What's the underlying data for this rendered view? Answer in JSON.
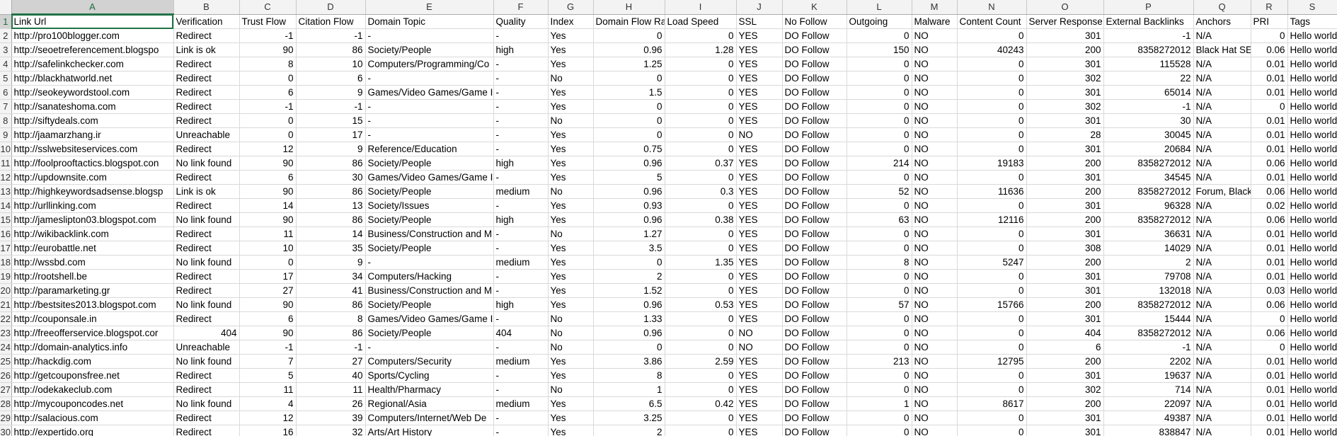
{
  "sheet": {
    "columns": [
      "A",
      "B",
      "C",
      "D",
      "E",
      "F",
      "G",
      "H",
      "I",
      "J",
      "K",
      "L",
      "M",
      "N",
      "O",
      "P",
      "Q",
      "R",
      "S"
    ],
    "numeric_columns": [
      2,
      3,
      7,
      8,
      11,
      13,
      14,
      15,
      17
    ],
    "header_row": [
      "Link Url",
      "Verification",
      "Trust Flow",
      "Citation Flow",
      "Domain Topic",
      "Quality",
      "Index",
      "Domain Flow Ra",
      "Load Speed",
      "SSL",
      "No Follow",
      "Outgoing",
      "Malware",
      "Content Count",
      "Server Response",
      "External Backlinks",
      "Anchors",
      "PRI",
      "Tags"
    ],
    "rows": [
      [
        "http://pro100blogger.com",
        "Redirect",
        "-1",
        "-1",
        "-",
        "-",
        "Yes",
        "0",
        "0",
        "YES",
        "DO Follow",
        "0",
        "NO",
        "0",
        "301",
        "-1",
        "N/A",
        "0",
        "Hello world"
      ],
      [
        "http://seoetreferencement.blogspo",
        "Link is ok",
        "90",
        "86",
        "Society/People",
        "high",
        "Yes",
        "0.96",
        "1.28",
        "YES",
        "DO Follow",
        "150",
        "NO",
        "40243",
        "200",
        "8358272012",
        "Black Hat SE(",
        "0.06",
        "Hello world"
      ],
      [
        "http://safelinkchecker.com",
        "Redirect",
        "8",
        "10",
        "Computers/Programming/Co",
        "-",
        "Yes",
        "1.25",
        "0",
        "YES",
        "DO Follow",
        "0",
        "NO",
        "0",
        "301",
        "115528",
        "N/A",
        "0.01",
        "Hello world"
      ],
      [
        "http://blackhatworld.net",
        "Redirect",
        "0",
        "6",
        "-",
        "-",
        "No",
        "0",
        "0",
        "YES",
        "DO Follow",
        "0",
        "NO",
        "0",
        "302",
        "22",
        "N/A",
        "0.01",
        "Hello world"
      ],
      [
        "http://seokeywordstool.com",
        "Redirect",
        "6",
        "9",
        "Games/Video Games/Game I",
        "-",
        "Yes",
        "1.5",
        "0",
        "YES",
        "DO Follow",
        "0",
        "NO",
        "0",
        "301",
        "65014",
        "N/A",
        "0.01",
        "Hello world"
      ],
      [
        "http://sanateshoma.com",
        "Redirect",
        "-1",
        "-1",
        "-",
        "-",
        "Yes",
        "0",
        "0",
        "YES",
        "DO Follow",
        "0",
        "NO",
        "0",
        "302",
        "-1",
        "N/A",
        "0",
        "Hello world"
      ],
      [
        "http://siftydeals.com",
        "Redirect",
        "0",
        "15",
        "-",
        "-",
        "No",
        "0",
        "0",
        "YES",
        "DO Follow",
        "0",
        "NO",
        "0",
        "301",
        "30",
        "N/A",
        "0.01",
        "Hello world"
      ],
      [
        "http://jaamarzhang.ir",
        "Unreachable",
        "0",
        "17",
        "-",
        "-",
        "Yes",
        "0",
        "0",
        "NO",
        "DO Follow",
        "0",
        "NO",
        "0",
        "28",
        "30045",
        "N/A",
        "0.01",
        "Hello world"
      ],
      [
        "http://sslwebsiteservices.com",
        "Redirect",
        "12",
        "9",
        "Reference/Education",
        "-",
        "Yes",
        "0.75",
        "0",
        "YES",
        "DO Follow",
        "0",
        "NO",
        "0",
        "301",
        "20684",
        "N/A",
        "0.01",
        "Hello world"
      ],
      [
        "http://foolprooftactics.blogspot.con",
        "No link found",
        "90",
        "86",
        "Society/People",
        "high",
        "Yes",
        "0.96",
        "0.37",
        "YES",
        "DO Follow",
        "214",
        "NO",
        "19183",
        "200",
        "8358272012",
        "N/A",
        "0.06",
        "Hello world"
      ],
      [
        "http://updownsite.com",
        "Redirect",
        "6",
        "30",
        "Games/Video Games/Game I",
        "-",
        "Yes",
        "5",
        "0",
        "YES",
        "DO Follow",
        "0",
        "NO",
        "0",
        "301",
        "34545",
        "N/A",
        "0.01",
        "Hello world"
      ],
      [
        "http://highkeywordsadsense.blogsp",
        "Link is ok",
        "90",
        "86",
        "Society/People",
        "medium",
        "No",
        "0.96",
        "0.3",
        "YES",
        "DO Follow",
        "52",
        "NO",
        "11636",
        "200",
        "8358272012",
        "Forum, Black",
        "0.06",
        "Hello world"
      ],
      [
        "http://urllinking.com",
        "Redirect",
        "14",
        "13",
        "Society/Issues",
        "-",
        "Yes",
        "0.93",
        "0",
        "YES",
        "DO Follow",
        "0",
        "NO",
        "0",
        "301",
        "96328",
        "N/A",
        "0.02",
        "Hello world"
      ],
      [
        "http://jameslipton03.blogspot.com",
        "No link found",
        "90",
        "86",
        "Society/People",
        "high",
        "Yes",
        "0.96",
        "0.38",
        "YES",
        "DO Follow",
        "63",
        "NO",
        "12116",
        "200",
        "8358272012",
        "N/A",
        "0.06",
        "Hello world"
      ],
      [
        "http://wikibacklink.com",
        "Redirect",
        "11",
        "14",
        "Business/Construction and M",
        "-",
        "No",
        "1.27",
        "0",
        "YES",
        "DO Follow",
        "0",
        "NO",
        "0",
        "301",
        "36631",
        "N/A",
        "0.01",
        "Hello world"
      ],
      [
        "http://eurobattle.net",
        "Redirect",
        "10",
        "35",
        "Society/People",
        "-",
        "Yes",
        "3.5",
        "0",
        "YES",
        "DO Follow",
        "0",
        "NO",
        "0",
        "308",
        "14029",
        "N/A",
        "0.01",
        "Hello world"
      ],
      [
        "http://wssbd.com",
        "No link found",
        "0",
        "9",
        "-",
        "medium",
        "Yes",
        "0",
        "1.35",
        "YES",
        "DO Follow",
        "8",
        "NO",
        "5247",
        "200",
        "2",
        "N/A",
        "0.01",
        "Hello world"
      ],
      [
        "http://rootshell.be",
        "Redirect",
        "17",
        "34",
        "Computers/Hacking",
        "-",
        "Yes",
        "2",
        "0",
        "YES",
        "DO Follow",
        "0",
        "NO",
        "0",
        "301",
        "79708",
        "N/A",
        "0.01",
        "Hello world"
      ],
      [
        "http://paramarketing.gr",
        "Redirect",
        "27",
        "41",
        "Business/Construction and M",
        "-",
        "Yes",
        "1.52",
        "0",
        "YES",
        "DO Follow",
        "0",
        "NO",
        "0",
        "301",
        "132018",
        "N/A",
        "0.03",
        "Hello world"
      ],
      [
        "http://bestsites2013.blogspot.com",
        "No link found",
        "90",
        "86",
        "Society/People",
        "high",
        "Yes",
        "0.96",
        "0.53",
        "YES",
        "DO Follow",
        "57",
        "NO",
        "15766",
        "200",
        "8358272012",
        "N/A",
        "0.06",
        "Hello world"
      ],
      [
        "http://couponsale.in",
        "Redirect",
        "6",
        "8",
        "Games/Video Games/Game I",
        "-",
        "No",
        "1.33",
        "0",
        "YES",
        "DO Follow",
        "0",
        "NO",
        "0",
        "301",
        "15444",
        "N/A",
        "0",
        "Hello world"
      ],
      [
        "http://freeofferservice.blogspot.cor",
        "404",
        "90",
        "86",
        "Society/People",
        "404",
        "No",
        "0.96",
        "0",
        "NO",
        "DO Follow",
        "0",
        "NO",
        "0",
        "404",
        "8358272012",
        "N/A",
        "0.06",
        "Hello world"
      ],
      [
        "http://domain-analytics.info",
        "Unreachable",
        "-1",
        "-1",
        "-",
        "-",
        "No",
        "0",
        "0",
        "NO",
        "DO Follow",
        "0",
        "NO",
        "0",
        "6",
        "-1",
        "N/A",
        "0",
        "Hello world"
      ],
      [
        "http://hackdig.com",
        "No link found",
        "7",
        "27",
        "Computers/Security",
        "medium",
        "Yes",
        "3.86",
        "2.59",
        "YES",
        "DO Follow",
        "213",
        "NO",
        "12795",
        "200",
        "2202",
        "N/A",
        "0.01",
        "Hello world"
      ],
      [
        "http://getcouponsfree.net",
        "Redirect",
        "5",
        "40",
        "Sports/Cycling",
        "-",
        "Yes",
        "8",
        "0",
        "YES",
        "DO Follow",
        "0",
        "NO",
        "0",
        "301",
        "19637",
        "N/A",
        "0.01",
        "Hello world"
      ],
      [
        "http://odekakeclub.com",
        "Redirect",
        "11",
        "11",
        "Health/Pharmacy",
        "-",
        "No",
        "1",
        "0",
        "YES",
        "DO Follow",
        "0",
        "NO",
        "0",
        "302",
        "714",
        "N/A",
        "0.01",
        "Hello world"
      ],
      [
        "http://mycouponcodes.net",
        "No link found",
        "4",
        "26",
        "Regional/Asia",
        "medium",
        "Yes",
        "6.5",
        "0.42",
        "YES",
        "DO Follow",
        "1",
        "NO",
        "8617",
        "200",
        "22097",
        "N/A",
        "0.01",
        "Hello world"
      ],
      [
        "http://salacious.com",
        "Redirect",
        "12",
        "39",
        "Computers/Internet/Web De",
        "-",
        "Yes",
        "3.25",
        "0",
        "YES",
        "DO Follow",
        "0",
        "NO",
        "0",
        "301",
        "49387",
        "N/A",
        "0.01",
        "Hello world"
      ],
      [
        "http://expertido.org",
        "Redirect",
        "16",
        "32",
        "Arts/Art History",
        "-",
        "Yes",
        "2",
        "0",
        "YES",
        "DO Follow",
        "0",
        "NO",
        "0",
        "301",
        "838847",
        "N/A",
        "0.01",
        "Hello world"
      ]
    ]
  }
}
